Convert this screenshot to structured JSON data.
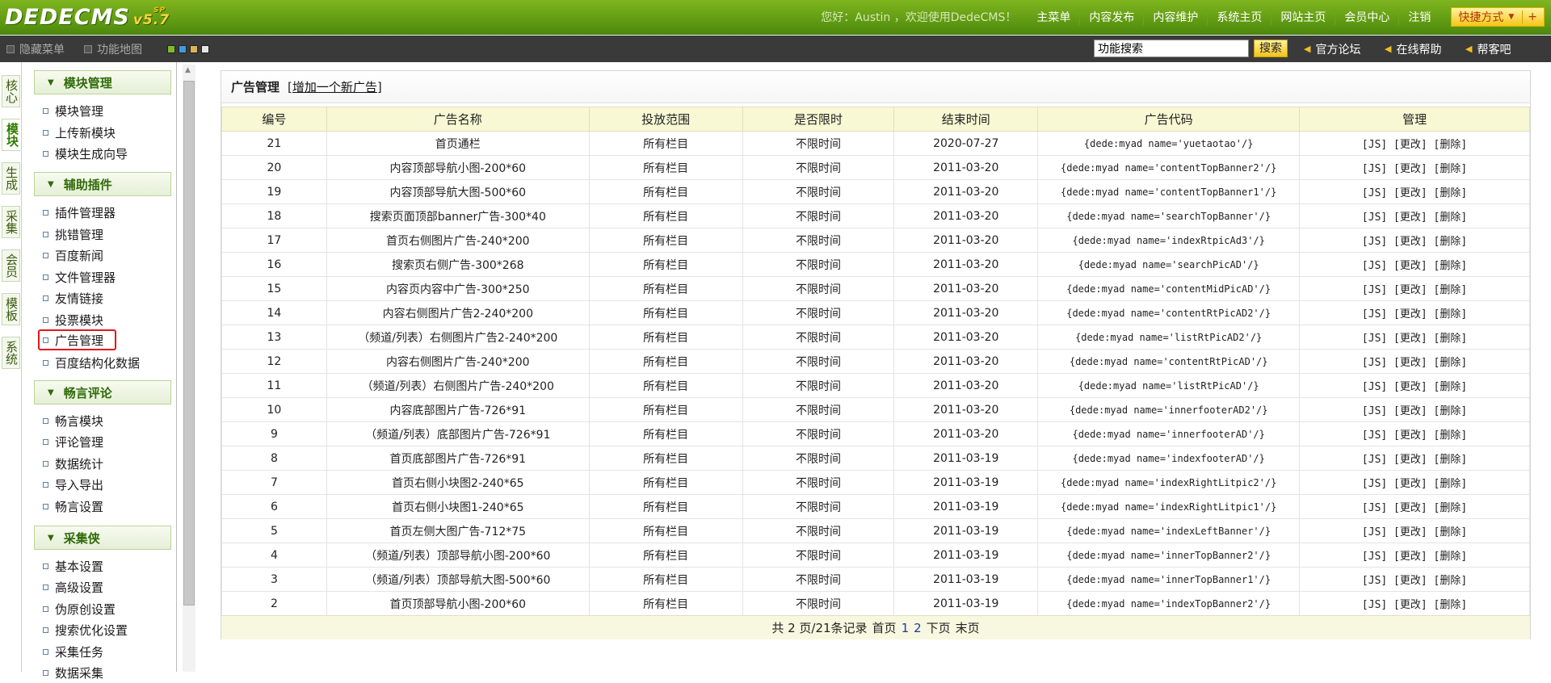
{
  "header": {
    "logo_text": "DEDECMS",
    "version": "v5.7",
    "version_sup": "SP",
    "welcome": "您好：Austin ，欢迎使用DedeCMS！",
    "nav": [
      "主菜单",
      "内容发布",
      "内容维护",
      "系统主页",
      "网站主页",
      "会员中心",
      "注销"
    ],
    "shortcut_label": "快捷方式",
    "shortcut_plus": "+"
  },
  "toolbar": {
    "hide_menu": "隐藏菜单",
    "func_map": "功能地图",
    "skin_colors": [
      "#7dbb2b",
      "#3f9be0",
      "#d9b55a",
      "#e6e6e6"
    ],
    "search_placeholder": "功能搜索",
    "search_button": "搜索",
    "links": [
      "官方论坛",
      "在线帮助",
      "帮客吧"
    ]
  },
  "left_tabs": [
    "核心",
    "模块",
    "生成",
    "采集",
    "会员",
    "模板",
    "系统"
  ],
  "sidebar": {
    "groups": [
      {
        "title": "模块管理",
        "items": [
          "模块管理",
          "上传新模块",
          "模块生成向导"
        ]
      },
      {
        "title": "辅助插件",
        "items": [
          "插件管理器",
          "挑错管理",
          "百度新闻",
          "文件管理器",
          "友情链接",
          "投票模块",
          "广告管理",
          "百度结构化数据"
        ]
      },
      {
        "title": "畅言评论",
        "items": [
          "畅言模块",
          "评论管理",
          "数据统计",
          "导入导出",
          "畅言设置"
        ]
      },
      {
        "title": "采集侠",
        "items": [
          "基本设置",
          "高级设置",
          "伪原创设置",
          "搜索优化设置",
          "采集任务",
          "数据采集"
        ]
      }
    ]
  },
  "main": {
    "title": "广告管理",
    "add_prefix": "[",
    "add_link": "增加一个新广告",
    "add_suffix": "]",
    "columns": [
      "编号",
      "广告名称",
      "投放范围",
      "是否限时",
      "结束时间",
      "广告代码",
      "管理"
    ],
    "rows": [
      [
        "21",
        "首页通栏",
        "所有栏目",
        "不限时间",
        "2020-07-27",
        "{dede:myad name='yuetaotao'/}",
        "[JS] [更改] [删除]"
      ],
      [
        "20",
        "内容顶部导航小图-200*60",
        "所有栏目",
        "不限时间",
        "2011-03-20",
        "{dede:myad name='contentTopBanner2'/}",
        "[JS] [更改] [删除]"
      ],
      [
        "19",
        "内容顶部导航大图-500*60",
        "所有栏目",
        "不限时间",
        "2011-03-20",
        "{dede:myad name='contentTopBanner1'/}",
        "[JS] [更改] [删除]"
      ],
      [
        "18",
        "搜索页面顶部banner广告-300*40",
        "所有栏目",
        "不限时间",
        "2011-03-20",
        "{dede:myad name='searchTopBanner'/}",
        "[JS] [更改] [删除]"
      ],
      [
        "17",
        "首页右侧图片广告-240*200",
        "所有栏目",
        "不限时间",
        "2011-03-20",
        "{dede:myad name='indexRtpicAd3'/}",
        "[JS] [更改] [删除]"
      ],
      [
        "16",
        "搜索页右侧广告-300*268",
        "所有栏目",
        "不限时间",
        "2011-03-20",
        "{dede:myad name='searchPicAD'/}",
        "[JS] [更改] [删除]"
      ],
      [
        "15",
        "内容页内容中广告-300*250",
        "所有栏目",
        "不限时间",
        "2011-03-20",
        "{dede:myad name='contentMidPicAD'/}",
        "[JS] [更改] [删除]"
      ],
      [
        "14",
        "内容右侧图片广告2-240*200",
        "所有栏目",
        "不限时间",
        "2011-03-20",
        "{dede:myad name='contentRtPicAD2'/}",
        "[JS] [更改] [删除]"
      ],
      [
        "13",
        "（频道/列表）右侧图片广告2-240*200",
        "所有栏目",
        "不限时间",
        "2011-03-20",
        "{dede:myad name='listRtPicAD2'/}",
        "[JS] [更改] [删除]"
      ],
      [
        "12",
        "内容右侧图片广告-240*200",
        "所有栏目",
        "不限时间",
        "2011-03-20",
        "{dede:myad name='contentRtPicAD'/}",
        "[JS] [更改] [删除]"
      ],
      [
        "11",
        "（频道/列表）右侧图片广告-240*200",
        "所有栏目",
        "不限时间",
        "2011-03-20",
        "{dede:myad name='listRtPicAD'/}",
        "[JS] [更改] [删除]"
      ],
      [
        "10",
        "内容底部图片广告-726*91",
        "所有栏目",
        "不限时间",
        "2011-03-20",
        "{dede:myad name='innerfooterAD2'/}",
        "[JS] [更改] [删除]"
      ],
      [
        "9",
        "（频道/列表）底部图片广告-726*91",
        "所有栏目",
        "不限时间",
        "2011-03-20",
        "{dede:myad name='innerfooterAD'/}",
        "[JS] [更改] [删除]"
      ],
      [
        "8",
        "首页底部图片广告-726*91",
        "所有栏目",
        "不限时间",
        "2011-03-19",
        "{dede:myad name='indexfooterAD'/}",
        "[JS] [更改] [删除]"
      ],
      [
        "7",
        "首页右侧小块图2-240*65",
        "所有栏目",
        "不限时间",
        "2011-03-19",
        "{dede:myad name='indexRightLitpic2'/}",
        "[JS] [更改] [删除]"
      ],
      [
        "6",
        "首页右侧小块图1-240*65",
        "所有栏目",
        "不限时间",
        "2011-03-19",
        "{dede:myad name='indexRightLitpic1'/}",
        "[JS] [更改] [删除]"
      ],
      [
        "5",
        "首页左侧大图广告-712*75",
        "所有栏目",
        "不限时间",
        "2011-03-19",
        "{dede:myad name='indexLeftBanner'/}",
        "[JS] [更改] [删除]"
      ],
      [
        "4",
        "（频道/列表）顶部导航小图-200*60",
        "所有栏目",
        "不限时间",
        "2011-03-19",
        "{dede:myad name='innerTopBanner2'/}",
        "[JS] [更改] [删除]"
      ],
      [
        "3",
        "（频道/列表）顶部导航大图-500*60",
        "所有栏目",
        "不限时间",
        "2011-03-19",
        "{dede:myad name='innerTopBanner1'/}",
        "[JS] [更改] [删除]"
      ],
      [
        "2",
        "首页顶部导航小图-200*60",
        "所有栏目",
        "不限时间",
        "2011-03-19",
        "{dede:myad name='indexTopBanner2'/}",
        "[JS] [更改] [删除]"
      ]
    ],
    "pager": {
      "summary": "共 2 页/21条记录",
      "first": "首页",
      "pages": [
        "1",
        "2"
      ],
      "next": "下页",
      "last": "末页"
    }
  }
}
